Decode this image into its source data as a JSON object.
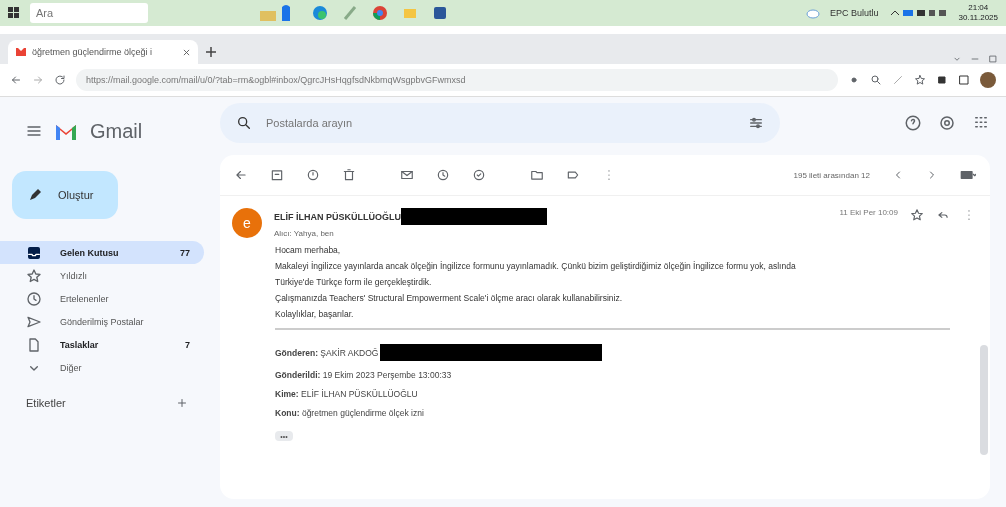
{
  "taskbar": {
    "search": {
      "placeholder": "Ara"
    },
    "weather": "EPC Bulutlu",
    "time": "21:04",
    "date": "30.11.2025"
  },
  "browser": {
    "tabs": [
      {
        "title": "öğretmen güçlendirme ölçeği i",
        "selected": true
      }
    ],
    "url": "https://mail.google.com/mail/u/0/?tab=rm&ogbl#inbox/QgrcJHsHqgfsdNkbmqWsgpbvGFwmxsd"
  },
  "gmail": {
    "logo": "Gmail",
    "search": {
      "placeholder": "Postalarda arayın"
    },
    "compose": "Oluştur",
    "nav": [
      {
        "label": "Gelen Kutusu",
        "count": "77",
        "selected": true,
        "unread": true
      },
      {
        "label": "Yıldızlı",
        "selected": false,
        "unread": false
      },
      {
        "label": "Ertelenenler",
        "selected": false,
        "unread": false
      },
      {
        "label": "Gönderilmiş Postalar",
        "selected": false,
        "unread": false
      },
      {
        "label": "Taslaklar",
        "count": "7",
        "selected": false,
        "unread": true
      },
      {
        "label": "Diğer",
        "selected": false,
        "unread": false
      }
    ],
    "labels_heading": "Etiketler",
    "pager": "195 ileti arasından 12",
    "message": {
      "avatar": "e",
      "sender": "ELİF İLHAN PÜSKÜLLÜOĞLU",
      "recipients": "Alıcı: Yahya, ben",
      "date": "11 Eki Per 10:09",
      "body": [
        "Hocam merhaba,",
        "Makaleyi İngilizce yayınlarda ancak ölçeğin İngilizce formunu yayınlamadık. Çünkü bizim geliştirdiğimiz ölçeğin İngilizce formu yok, aslında",
        "Türkiye'de Türkçe form ile gerçekleştirdik.",
        "Çalışmanızda Teachers' Structural Empowerment Scale'i ölçme aracı olarak kullanabilirsiniz.",
        "Kolaylıklar, başarılar."
      ],
      "forwarded": [
        {
          "text": "**Gönderen:** ŞAKİR AKDOĞ",
          "redacted": true
        },
        {
          "text": "**Gönderildi:** 19 Ekim 2023 Perşembe 13:00:33",
          "redacted": false
        },
        {
          "text": "**Kime:** ELİF İLHAN PÜSKÜLLÜOĞLU",
          "redacted": false
        },
        {
          "text": "**Konu:** öğretmen güçlendirme ölçek izni",
          "redacted": false
        }
      ],
      "ellipsis": "•••"
    }
  }
}
